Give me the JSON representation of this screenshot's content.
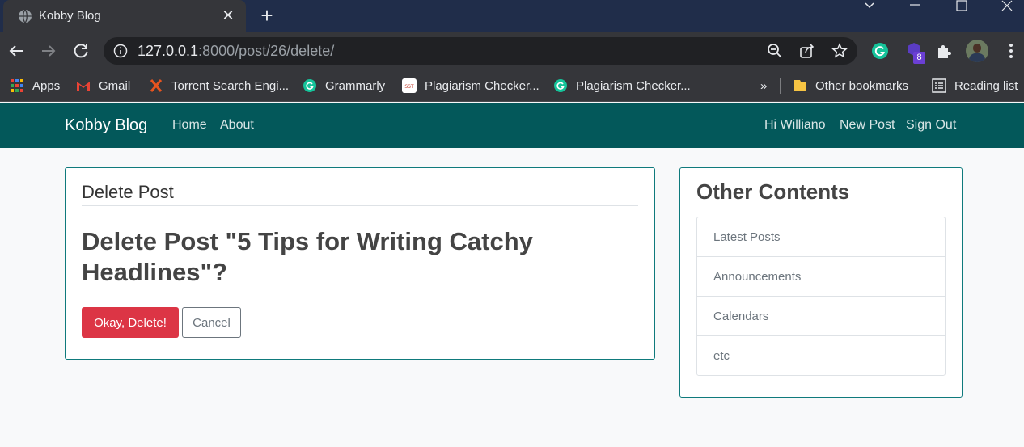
{
  "browser": {
    "tab_title": "Kobby Blog",
    "url_host": "127.0.0.1",
    "url_rest": ":8000/post/26/delete/",
    "extension_badge": "8",
    "bookmarks": [
      "Apps",
      "Gmail",
      "Torrent Search Engi...",
      "Grammarly",
      "Plagiarism Checker...",
      "Plagiarism Checker..."
    ],
    "overflow": "»",
    "other_bookmarks": "Other bookmarks",
    "reading_list": "Reading list"
  },
  "site": {
    "brand": "Kobby Blog",
    "nav_left": [
      "Home",
      "About"
    ],
    "nav_right": [
      "Hi Williano",
      "New Post",
      "Sign Out"
    ]
  },
  "main": {
    "header": "Delete Post",
    "confirm_text": "Delete Post \"5 Tips for Writing Catchy Headlines\"?",
    "confirm_button": "Okay, Delete!",
    "cancel_button": "Cancel"
  },
  "sidebar": {
    "title": "Other Contents",
    "items": [
      "Latest Posts",
      "Announcements",
      "Calendars",
      "etc"
    ]
  },
  "colors": {
    "navbar": "#03585a",
    "danger": "#dc3545",
    "card_border": "#0f7a7c"
  }
}
